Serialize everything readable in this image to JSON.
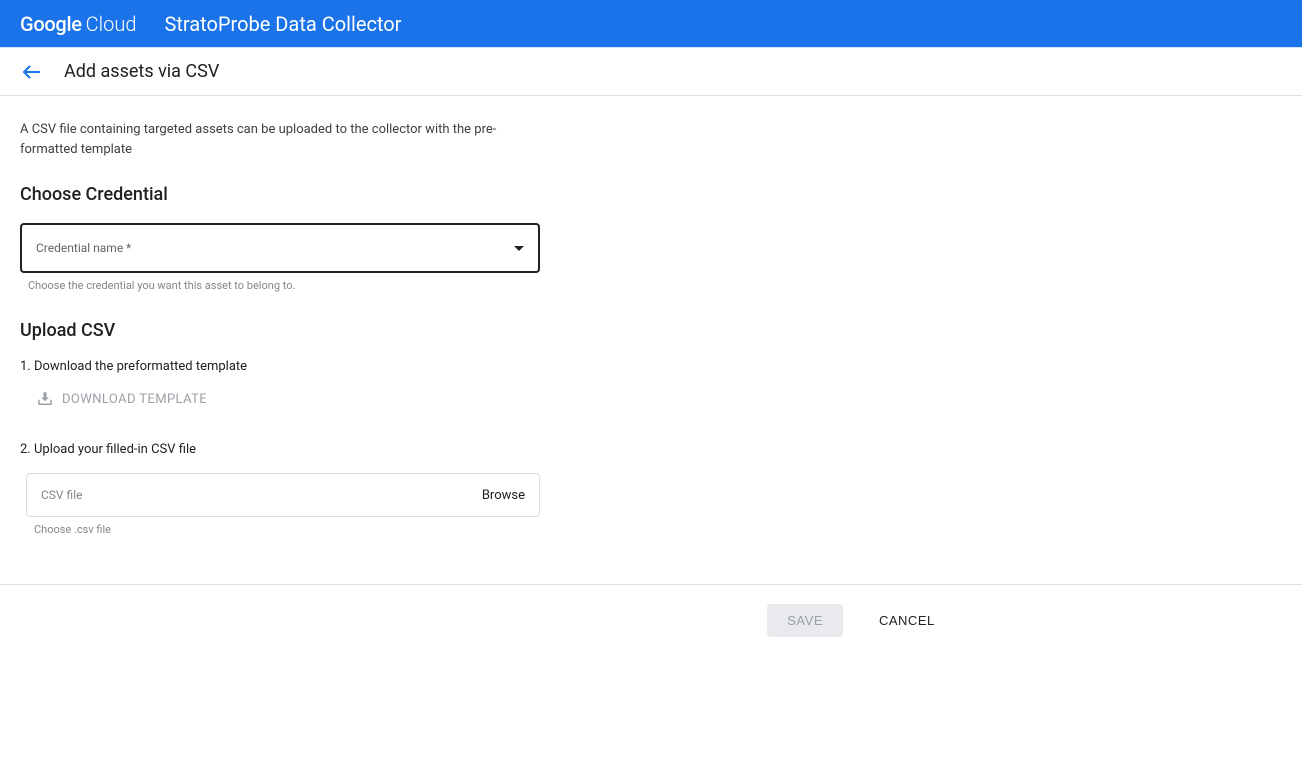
{
  "header": {
    "logo_google": "Google",
    "logo_cloud": "Cloud",
    "app_title": "StratoProbe Data Collector"
  },
  "subheader": {
    "page_title": "Add assets via CSV"
  },
  "intro": "A CSV file containing targeted assets can be uploaded to the collector with the pre-formatted template",
  "credential": {
    "heading": "Choose Credential",
    "label": "Credential name *",
    "helper": "Choose the credential you want this asset to belong to."
  },
  "upload": {
    "heading": "Upload CSV",
    "step1": "1. Download the preformatted template",
    "download_label": "DOWNLOAD TEMPLATE",
    "step2": "2. Upload your filled-in CSV file",
    "csv_placeholder": "CSV file",
    "browse_label": "Browse",
    "csv_helper": "Choose .csv file"
  },
  "footer": {
    "save_label": "SAVE",
    "cancel_label": "CANCEL"
  }
}
